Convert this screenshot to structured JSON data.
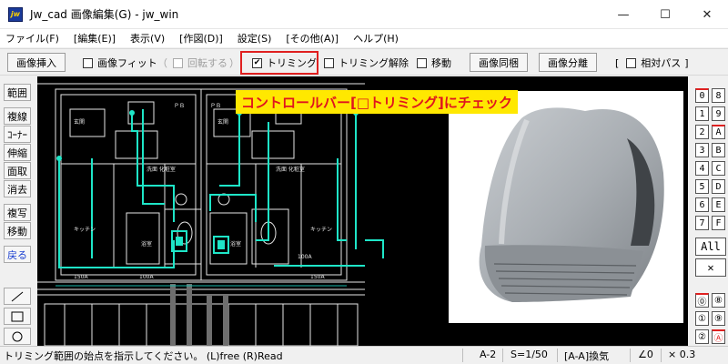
{
  "window": {
    "icon_text": "jw",
    "title": "Jw_cad 画像編集(G) - jw_win",
    "minimize": "—",
    "maximize": "☐",
    "close": "✕"
  },
  "menu": [
    "ファイル(F)",
    "[編集(E)]",
    "表示(V)",
    "[作図(D)]",
    "設定(S)",
    "[その他(A)]",
    "ヘルプ(H)"
  ],
  "controlbar": {
    "insert_image": "画像挿入",
    "fit_image": "画像フィット",
    "rotate_open": "（",
    "rotate": "回転する",
    "rotate_close": "）",
    "trimming": "トリミング",
    "trimming_checked": true,
    "trimming_check_mark": "✔",
    "trimming_release": "トリミング解除",
    "move": "移動",
    "image_bundle": "画像同梱",
    "image_separate": "画像分離",
    "relative_open": "[",
    "relative_path": "相対パス",
    "relative_close": "]"
  },
  "left_toolbar": [
    "範囲",
    "複線",
    "ｺｰﾅｰ",
    "伸縮",
    "面取",
    "消去",
    "複写",
    "移動",
    "戻る"
  ],
  "left_shapes": [
    "line-icon",
    "rectangle-icon",
    "circle-icon"
  ],
  "right_toolbar": {
    "pairs": [
      [
        "0",
        "8"
      ],
      [
        "1",
        "9"
      ],
      [
        "2",
        "A"
      ],
      [
        "3",
        "B"
      ],
      [
        "4",
        "C"
      ],
      [
        "5",
        "D"
      ],
      [
        "6",
        "E"
      ],
      [
        "7",
        "F"
      ]
    ],
    "all": "All",
    "cross": "✕",
    "pairs2": [
      [
        "⓪",
        "⑧"
      ],
      [
        "①",
        "⑨"
      ],
      [
        "②",
        "Ⓐ"
      ]
    ]
  },
  "annotation": "コントロールバー[□トリミング]にチェック",
  "cad": {
    "room_labels": [
      "玄関",
      "玄関",
      "洗面\n化粧室",
      "洗面\n化粧室",
      "キッチン",
      "キッチン",
      "浴室",
      "浴室",
      "150A",
      "100A",
      "100A",
      "150A",
      "ＰＢ",
      "ＰＢ"
    ]
  },
  "status": {
    "message": "トリミング範囲の始点を指示してください。 (L)free (R)Read",
    "layer": "A-2",
    "scale": "S=1/50",
    "ventilation": "[A-A]換気",
    "angle": "∠0",
    "zoom": "× 0.3"
  },
  "colors": {
    "canvas_bg": "#000000",
    "cad_white": "#e6e6e6",
    "cad_cyan": "#1ee6c8",
    "cad_teal": "#16b9aa",
    "annotation_bg": "#ffe800",
    "annotation_text": "#e0141e",
    "highlight": "#e02020"
  }
}
